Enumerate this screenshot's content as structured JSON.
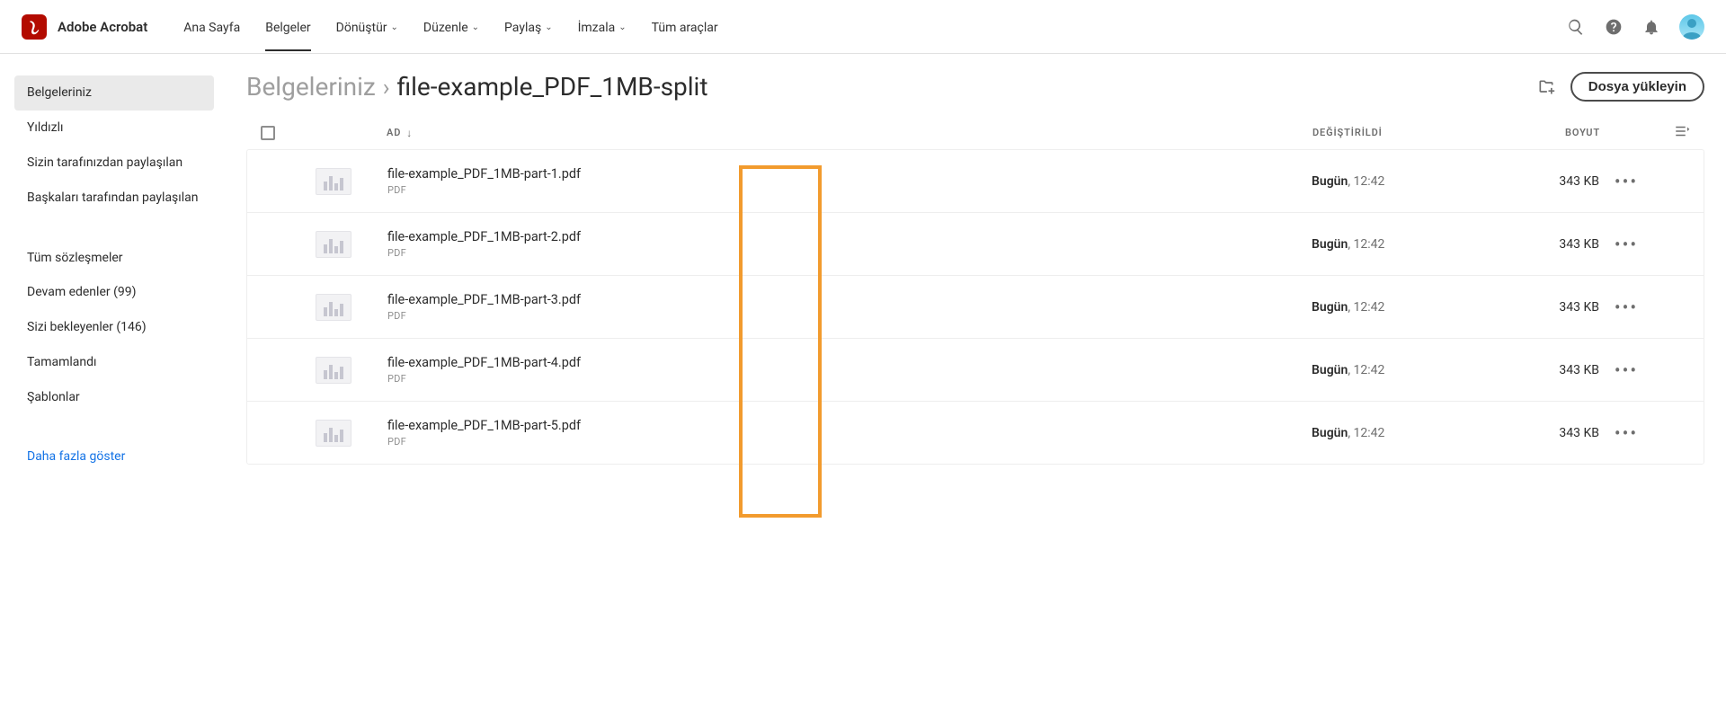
{
  "app": {
    "name": "Adobe Acrobat"
  },
  "nav": {
    "items": [
      {
        "label": "Ana Sayfa",
        "dropdown": false,
        "active": false
      },
      {
        "label": "Belgeler",
        "dropdown": false,
        "active": true
      },
      {
        "label": "Dönüştür",
        "dropdown": true,
        "active": false
      },
      {
        "label": "Düzenle",
        "dropdown": true,
        "active": false
      },
      {
        "label": "Paylaş",
        "dropdown": true,
        "active": false
      },
      {
        "label": "İmzala",
        "dropdown": true,
        "active": false
      },
      {
        "label": "Tüm araçlar",
        "dropdown": false,
        "active": false
      }
    ]
  },
  "sidebar": {
    "group1": [
      {
        "label": "Belgeleriniz",
        "active": true
      },
      {
        "label": "Yıldızlı",
        "active": false
      },
      {
        "label": "Sizin tarafınızdan paylaşılan",
        "active": false
      },
      {
        "label": "Başkaları tarafından paylaşılan",
        "active": false
      }
    ],
    "group2": [
      {
        "label": "Tüm sözleşmeler"
      },
      {
        "label": "Devam edenler (99)"
      },
      {
        "label": "Sizi bekleyenler (146)"
      },
      {
        "label": "Tamamlandı"
      },
      {
        "label": "Şablonlar"
      }
    ],
    "more": "Daha fazla göster"
  },
  "breadcrumb": {
    "root": "Belgeleriniz",
    "sep": "›",
    "current": "file-example_PDF_1MB-split"
  },
  "actions": {
    "upload": "Dosya yükleyin"
  },
  "table": {
    "headers": {
      "name": "AD",
      "modified": "DEĞİŞTİRİLDİ",
      "size": "BOYUT"
    },
    "rows": [
      {
        "name": "file-example_PDF_1MB-part-1.pdf",
        "type": "PDF",
        "mod_day": "Bugün",
        "mod_time": ", 12:42",
        "size": "343 KB"
      },
      {
        "name": "file-example_PDF_1MB-part-2.pdf",
        "type": "PDF",
        "mod_day": "Bugün",
        "mod_time": ", 12:42",
        "size": "343 KB"
      },
      {
        "name": "file-example_PDF_1MB-part-3.pdf",
        "type": "PDF",
        "mod_day": "Bugün",
        "mod_time": ", 12:42",
        "size": "343 KB"
      },
      {
        "name": "file-example_PDF_1MB-part-4.pdf",
        "type": "PDF",
        "mod_day": "Bugün",
        "mod_time": ", 12:42",
        "size": "343 KB"
      },
      {
        "name": "file-example_PDF_1MB-part-5.pdf",
        "type": "PDF",
        "mod_day": "Bugün",
        "mod_time": ", 12:42",
        "size": "343 KB"
      }
    ]
  }
}
